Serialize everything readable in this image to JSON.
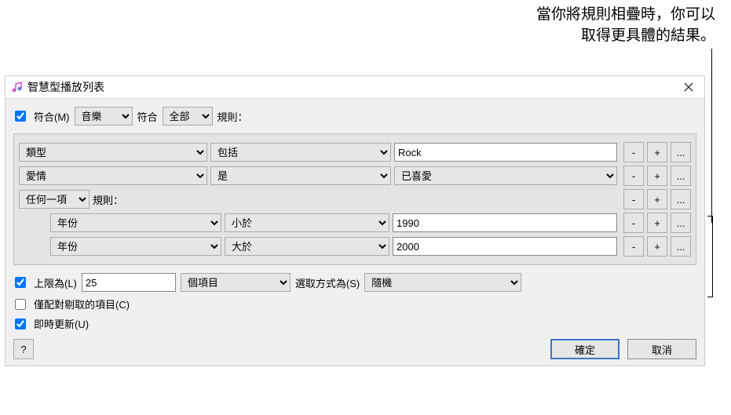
{
  "annotation": {
    "line1": "當你將規則相疊時，你可以",
    "line2": "取得更具體的結果。"
  },
  "dialog": {
    "title": "智慧型播放列表",
    "match": {
      "checkbox_label": "符合(M)",
      "source": "音樂",
      "middle_label": "符合",
      "condition": "全部",
      "suffix": "規則："
    },
    "rules": [
      {
        "field": "類型",
        "op": "包括",
        "value": "Rock",
        "value_type": "text"
      },
      {
        "field": "愛情",
        "op": "是",
        "value": "已喜愛",
        "value_type": "select"
      }
    ],
    "nested": {
      "header_select": "任何一項",
      "header_suffix": "規則：",
      "rules": [
        {
          "field": "年份",
          "op": "小於",
          "value": "1990"
        },
        {
          "field": "年份",
          "op": "大於",
          "value": "2000"
        }
      ]
    },
    "limit": {
      "checkbox_label": "上限為(L)",
      "value": "25",
      "unit": "個項目",
      "selected_by_label": "選取方式為(S)",
      "selected_by": "隨機"
    },
    "only_checked_label": "僅配對剔取的項目(C)",
    "live_update_label": "即時更新(U)",
    "buttons": {
      "help": "?",
      "ok": "確定",
      "cancel": "取消",
      "minus": "-",
      "plus": "+",
      "more": "..."
    }
  }
}
